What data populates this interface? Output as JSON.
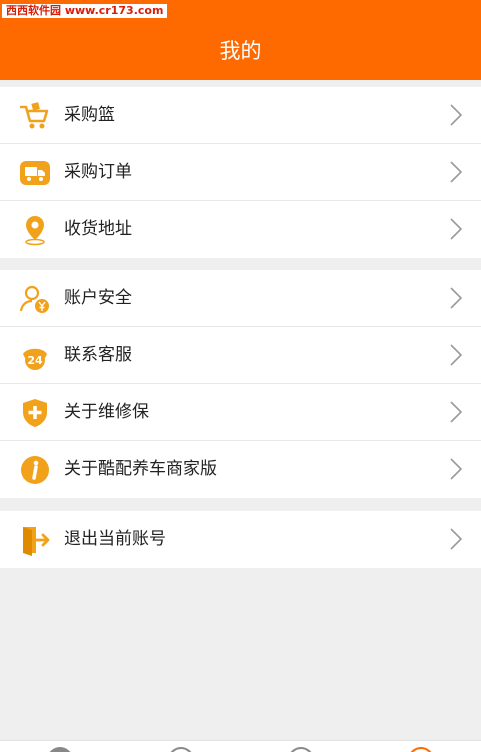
{
  "watermark": "西西软件园 www.cr173.com",
  "header": {
    "title": "我的"
  },
  "colors": {
    "accent": "#ff6a00",
    "icon": "#f2a11a",
    "background": "#efefef"
  },
  "groups": [
    {
      "items": [
        {
          "label": "采购篮",
          "icon": "shopping-cart-icon"
        },
        {
          "label": "采购订单",
          "icon": "delivery-truck-icon"
        },
        {
          "label": "收货地址",
          "icon": "location-pin-icon"
        }
      ]
    },
    {
      "items": [
        {
          "label": "账户安全",
          "icon": "user-security-icon"
        },
        {
          "label": "联系客服",
          "icon": "phone-24-icon"
        },
        {
          "label": "关于维修保",
          "icon": "shield-cross-icon"
        },
        {
          "label": "关于酷配养车商家版",
          "icon": "info-icon"
        }
      ]
    },
    {
      "items": [
        {
          "label": "退出当前账号",
          "icon": "logout-icon"
        }
      ]
    }
  ],
  "tabbar": {
    "tabs": [
      "home-tab-icon",
      "category-tab-icon",
      "message-tab-icon",
      "profile-tab-icon"
    ],
    "active": 3
  }
}
